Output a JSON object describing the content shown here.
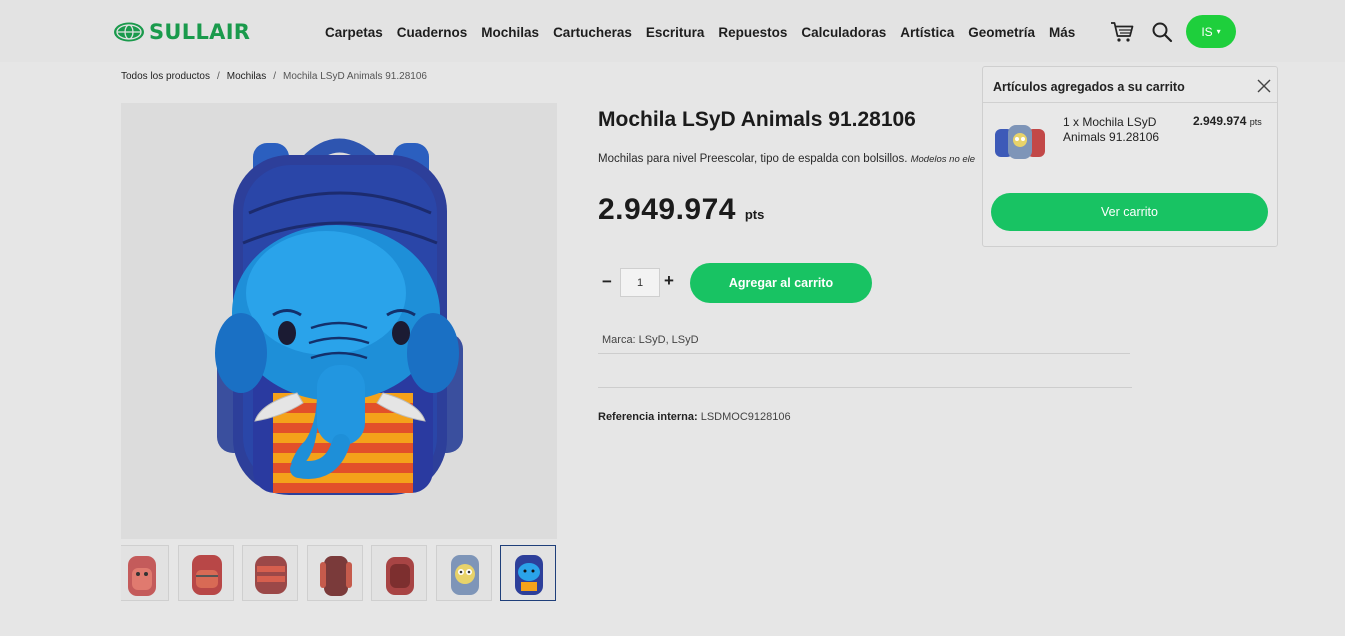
{
  "brand": {
    "name": "SULLAIR"
  },
  "nav": {
    "items": [
      "Carpetas",
      "Cuadernos",
      "Mochilas",
      "Cartucheras",
      "Escritura",
      "Repuestos",
      "Calculadoras",
      "Artística",
      "Geometría",
      "Más"
    ]
  },
  "header": {
    "cart_icon": "cart-icon",
    "search_icon": "search-icon",
    "user_initials": "IS",
    "user_caret": "▾"
  },
  "breadcrumb": {
    "items": [
      "Todos los productos",
      "Mochilas",
      "Mochila LSyD Animals 91.28106"
    ],
    "separator": "/"
  },
  "product": {
    "title": "Mochila LSyD Animals 91.28106",
    "description": "Mochilas para nivel Preescolar, tipo de espalda con bolsillos.",
    "description_note": "Modelos no ele",
    "price": "2.949.974",
    "price_unit": "pts",
    "quantity": "1",
    "qty_minus": "−",
    "qty_plus": "+",
    "add_to_cart_label": "Agregar al carrito",
    "brand_label": "Marca: LSyD, LSyD",
    "ref_label": "Referencia interna:",
    "ref_value": "LSDMOC9128106"
  },
  "gallery": {
    "thumb_count": 7,
    "active_index": 6
  },
  "cart_popup": {
    "title": "Artículos agregados a su carrito",
    "item_name": "1 x Mochila LSyD Animals 91.28106",
    "item_price": "2.949.974",
    "item_price_unit": "pts",
    "view_cart_label": "Ver carrito"
  },
  "colors": {
    "brand_green": "#1a9a4c",
    "button_green": "#18c363",
    "user_green": "#1ecf3c",
    "background": "#e6e6e6"
  }
}
